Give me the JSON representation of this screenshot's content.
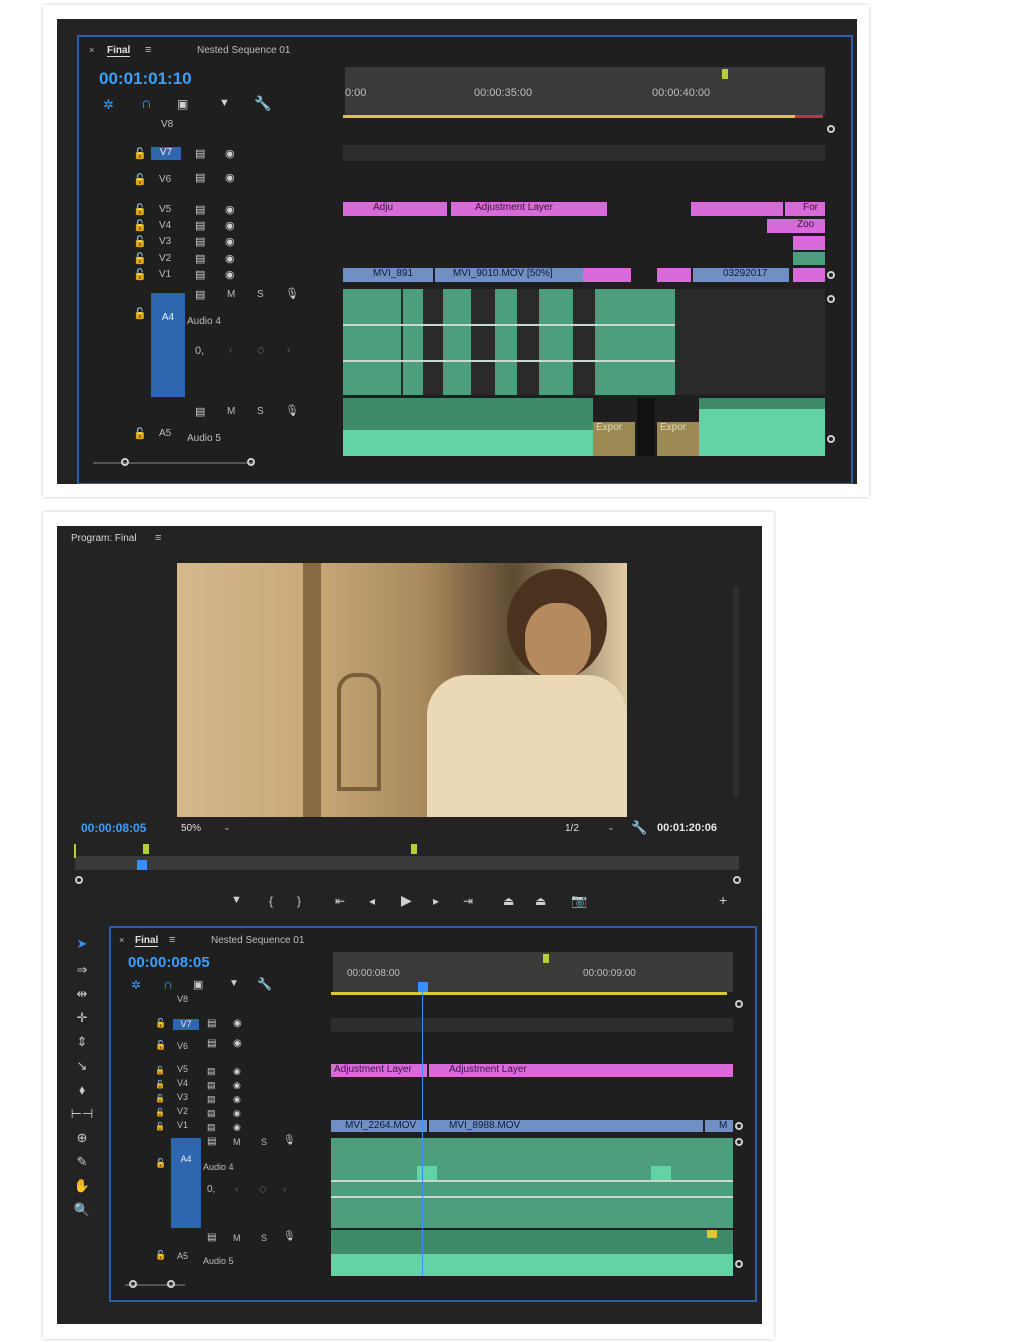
{
  "top": {
    "tab_close": "×",
    "tab_active": "Final",
    "tab_menu": "≡",
    "tab_other": "Nested Sequence 01",
    "timecode": "00:01:01:10",
    "ruler_labels": [
      "0:00",
      "00:00:35:00",
      "00:00:40:00"
    ],
    "tracks": {
      "v8": "V8",
      "v7": "V7",
      "v6": "V6",
      "v5": "V5",
      "v4": "V4",
      "v3": "V3",
      "v2": "V2",
      "v1": "V1",
      "a4": "A4",
      "a5": "A5"
    },
    "audio4_name": "Audio 4",
    "audio5_name": "Audio 5",
    "audio_m": "M",
    "audio_s": "S",
    "vol_value": "0,",
    "clips": {
      "adj1": "Adju",
      "adj2": "Adjustment Layer",
      "for": "For",
      "zoo": "Zoo",
      "mvi1": "MVI_891",
      "mvi2": "MVI_9010.MOV [50%]",
      "date": "03292017",
      "export1": "Expor",
      "export2": "Expor"
    }
  },
  "bottom": {
    "program_title": "Program: Final",
    "program_menu": "≡",
    "timecode_left": "00:00:08:05",
    "zoom": "50%",
    "resolution": "1/2",
    "timecode_right": "00:01:20:06",
    "tab_close": "×",
    "tab_active": "Final",
    "tab_menu": "≡",
    "tab_other": "Nested Sequence 01",
    "seq_timecode": "00:00:08:05",
    "ruler_labels": [
      "00:00:08:00",
      "00:00:09:00"
    ],
    "tracks": {
      "v8": "V8",
      "v7": "V7",
      "v6": "V6",
      "v5": "V5",
      "v4": "V4",
      "v3": "V3",
      "v2": "V2",
      "v1": "V1",
      "a4": "A4",
      "a5": "A5"
    },
    "audio4_name": "Audio 4",
    "audio5_name": "Audio 5",
    "audio_m": "M",
    "audio_s": "S",
    "vol_value": "0,",
    "clips": {
      "adj1": "Adjustment Layer",
      "adj2": "Adjustment Layer",
      "mvi1": "MVI_2264.MOV",
      "mvi2": "MVI_8988.MOV",
      "end": "M"
    }
  }
}
